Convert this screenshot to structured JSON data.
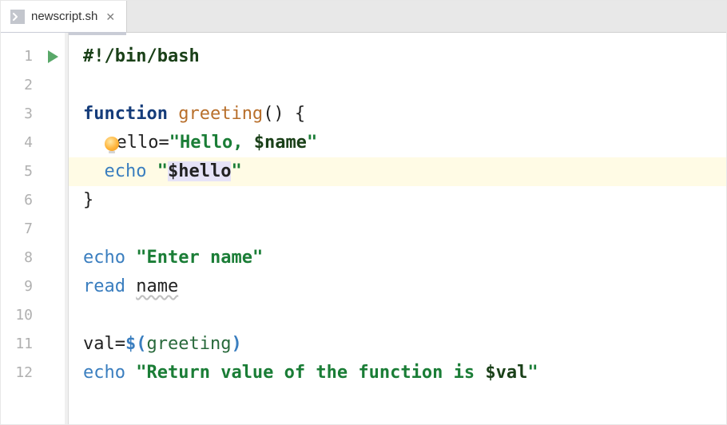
{
  "tab": {
    "filename": "newscript.sh",
    "close_glyph": "✕"
  },
  "gutter": {
    "lines": [
      "1",
      "2",
      "3",
      "4",
      "5",
      "6",
      "7",
      "8",
      "9",
      "10",
      "11",
      "12"
    ]
  },
  "code": {
    "highlighted_line_index": 4,
    "l1_shebang": "#!/bin/bash",
    "l3_function": "function",
    "l3_name": "greeting",
    "l3_tail": "() {",
    "l4_ello": "ello",
    "l4_eq": "=",
    "l4_q1": "\"",
    "l4_hello_txt": "Hello, ",
    "l4_var": "$name",
    "l4_q2": "\"",
    "l5_echo": "echo",
    "l5_q1": "\"",
    "l5_var": "$hello",
    "l5_q2": "\"",
    "l6_close": "}",
    "l8_echo": "echo",
    "l8_q1": "\"",
    "l8_str": "Enter name",
    "l8_q2": "\"",
    "l9_read": "read",
    "l9_name": "name",
    "l11_val": "val",
    "l11_eq": "=",
    "l11_open": "$(",
    "l11_call": "greeting",
    "l11_close": ")",
    "l12_echo": "echo",
    "l12_q1": "\"",
    "l12_str": "Return value of the function is ",
    "l12_var": "$val",
    "l12_q2": "\""
  }
}
